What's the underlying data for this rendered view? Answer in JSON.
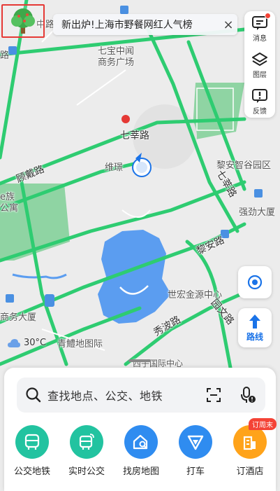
{
  "banner": {
    "text": "新出炉!上海市野餐网红人气榜",
    "close": "×"
  },
  "right_panel": [
    {
      "label": "消息",
      "icon": "message-icon"
    },
    {
      "label": "图层",
      "icon": "layers-icon"
    },
    {
      "label": "反馈",
      "icon": "feedback-icon"
    }
  ],
  "route_label": "路线",
  "weather": {
    "temp": "30°C",
    "icon": "cloud-icon"
  },
  "map_labels": {
    "zhonglu": "中路",
    "lu_left": "路",
    "qibao_line1": "七宝中闻",
    "qibao_line2": "商务广场",
    "qixin_road": "七莘路",
    "weiqing": "维璟",
    "gufang_road": "顾戴路",
    "qixin_road_v": "七莘路",
    "liyuan": "黎安智谷园区",
    "ezu": "e族",
    "gongyu": "公寓",
    "qiangjin": "强劲大厦",
    "lian_road": "黎安路",
    "shihong": "世宏金源中心",
    "shangwu": "商务大厦",
    "qiaotai": "青鱧地图际",
    "xiubo_road": "秀波路",
    "yuanwen_road": "园文路",
    "xizi": "西子国际中心"
  },
  "search": {
    "placeholder": "查找地点、公交、地铁"
  },
  "shortcuts": [
    {
      "label": "公交地铁",
      "color": "#22c3a0",
      "icon": "bus-icon"
    },
    {
      "label": "实时公交",
      "color": "#22c3a0",
      "icon": "realtime-bus-icon"
    },
    {
      "label": "找房地图",
      "color": "#2f8cf0",
      "icon": "house-search-icon"
    },
    {
      "label": "打车",
      "color": "#2f8cf0",
      "icon": "taxi-icon"
    },
    {
      "label": "订酒店",
      "color": "#ffa31a",
      "icon": "hotel-icon"
    }
  ],
  "hotel_badge": "订周末",
  "colors": {
    "accent": "#1a73e8",
    "road": "#2ecc71",
    "green_area": "#7fcf98",
    "water": "#4a90e2"
  }
}
